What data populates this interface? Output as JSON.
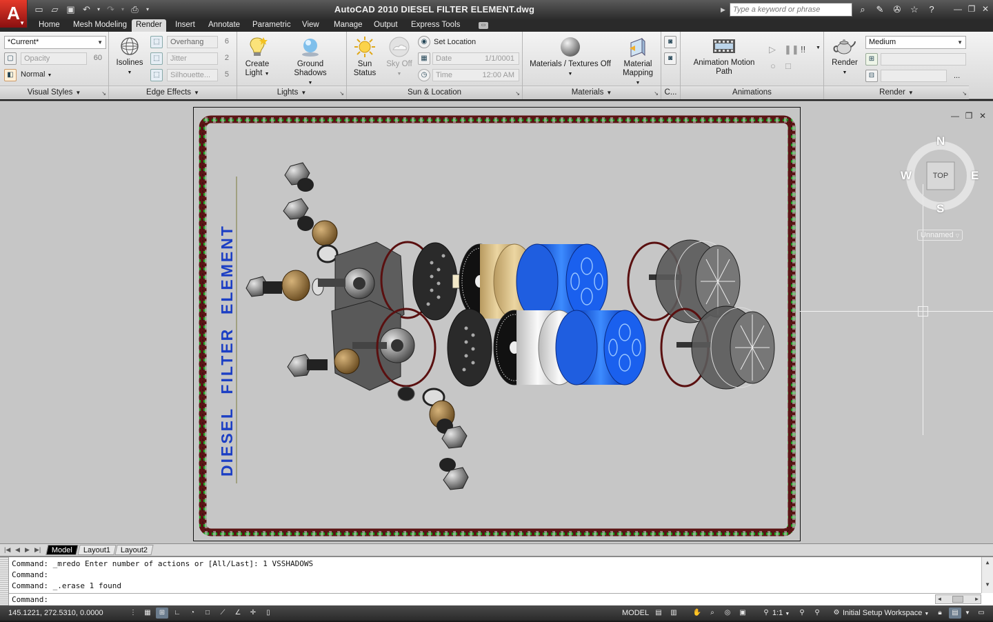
{
  "window": {
    "title": "AutoCAD 2010    DIESEL FILTER ELEMENT.dwg",
    "app_logo": "A",
    "search_placeholder": "Type a keyword or phrase"
  },
  "quick_access_icons": [
    "new-icon",
    "open-icon",
    "save-icon",
    "undo-icon",
    "redo-icon",
    "plot-icon"
  ],
  "ribbon_tabs": [
    {
      "label": "Home",
      "active": false
    },
    {
      "label": "Mesh Modeling",
      "active": false
    },
    {
      "label": "Render",
      "active": true
    },
    {
      "label": "Insert",
      "active": false
    },
    {
      "label": "Annotate",
      "active": false
    },
    {
      "label": "Parametric",
      "active": false
    },
    {
      "label": "View",
      "active": false
    },
    {
      "label": "Manage",
      "active": false
    },
    {
      "label": "Output",
      "active": false
    },
    {
      "label": "Express Tools",
      "active": false
    }
  ],
  "panels": {
    "visual_styles": {
      "title": "Visual Styles",
      "current_style": "*Current*",
      "opacity_label": "Opacity",
      "opacity_value": "60",
      "face_style": "Normal"
    },
    "edge_effects": {
      "title": "Edge Effects",
      "isolines_label": "Isolines",
      "overhang_label": "Overhang",
      "overhang_value": "6",
      "jitter_label": "Jitter",
      "jitter_value": "2",
      "silhouette_label": "Silhouette...",
      "silhouette_value": "5"
    },
    "lights": {
      "title": "Lights",
      "create_light_label_1": "Create",
      "create_light_label_2": "Light",
      "ground_shadows_label": "Ground Shadows"
    },
    "sun_location": {
      "title": "Sun & Location",
      "sun_status_1": "Sun",
      "sun_status_2": "Status",
      "sky_off_label": "Sky Off",
      "set_location_label": "Set Location",
      "date_label": "Date",
      "date_value": "1/1/0001",
      "time_label": "Time",
      "time_value": "12:00 AM"
    },
    "materials": {
      "title": "Materials",
      "materials_textures_label": "Materials / Textures Off",
      "material_mapping_1": "Material",
      "material_mapping_2": "Mapping"
    },
    "camera": {
      "title": "C..."
    },
    "animations": {
      "title": "Animations",
      "motion_path_label": "Animation Motion Path"
    },
    "render": {
      "title": "Render",
      "render_label": "Render",
      "quality_value": "Medium",
      "more_label": "..."
    }
  },
  "drawing": {
    "vertical_title": "DIESEL  FILTER  ELEMENT",
    "title_color": "#1c3fc4"
  },
  "viewcube": {
    "north": "N",
    "south": "S",
    "east": "E",
    "west": "W",
    "face": "TOP",
    "ucs_name": "Unnamed"
  },
  "layout_tabs": [
    {
      "label": "Model",
      "active": true
    },
    {
      "label": "Layout1",
      "active": false
    },
    {
      "label": "Layout2",
      "active": false
    }
  ],
  "command_history": [
    "Command: _mredo Enter number of actions or [All/Last]: 1 VSSHADOWS",
    "Command:",
    "Command: _.erase 1 found"
  ],
  "command_prompt": "Command:",
  "status_bar": {
    "coordinates": "145.1221, 272.5310, 0.0000",
    "model_label": "MODEL",
    "annotation_scale": "1:1",
    "workspace": "Initial Setup Workspace"
  },
  "colors": {
    "accent_blue": "#2a63d8",
    "app_red": "#c8281c",
    "border_red": "#6a1616",
    "border_green": "#1f9a1f"
  }
}
